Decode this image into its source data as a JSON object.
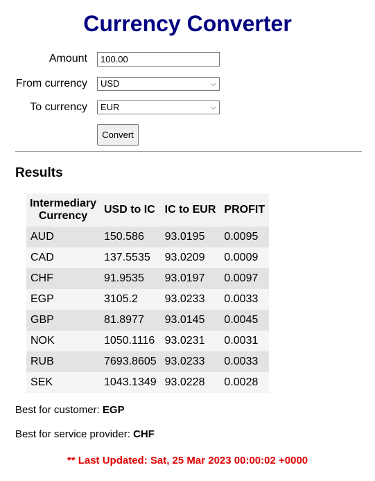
{
  "title": "Currency Converter",
  "form": {
    "amount_label": "Amount",
    "amount_value": "100.00",
    "from_label": "From currency",
    "from_value": "USD",
    "to_label": "To currency",
    "to_value": "EUR",
    "convert_label": "Convert"
  },
  "results": {
    "heading": "Results",
    "columns": [
      "Intermediary Currency",
      "USD to IC",
      "IC to EUR",
      "PROFIT"
    ],
    "rows": [
      [
        "AUD",
        "150.586",
        "93.0195",
        "0.0095"
      ],
      [
        "CAD",
        "137.5535",
        "93.0209",
        "0.0009"
      ],
      [
        "CHF",
        "91.9535",
        "93.0197",
        "0.0097"
      ],
      [
        "EGP",
        "3105.2",
        "93.0233",
        "0.0033"
      ],
      [
        "GBP",
        "81.8977",
        "93.0145",
        "0.0045"
      ],
      [
        "NOK",
        "1050.1116",
        "93.0231",
        "0.0031"
      ],
      [
        "RUB",
        "7693.8605",
        "93.0233",
        "0.0033"
      ],
      [
        "SEK",
        "1043.1349",
        "93.0228",
        "0.0028"
      ]
    ]
  },
  "best_customer": {
    "label": "Best for customer:",
    "value": "EGP"
  },
  "best_provider": {
    "label": "Best for service provider:",
    "value": "CHF"
  },
  "last_updated": "** Last Updated: Sat, 25 Mar 2023 00:00:02 +0000",
  "colors": {
    "title": "#000080",
    "last_updated": "#e00000"
  }
}
